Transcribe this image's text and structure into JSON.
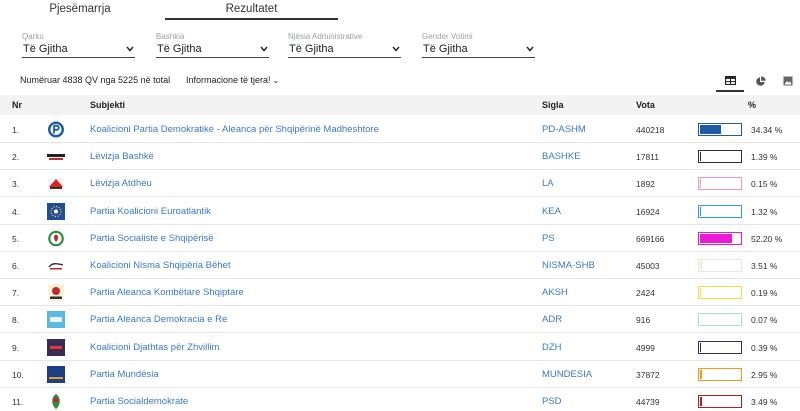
{
  "tabs": [
    {
      "label": "Pjesëmarrja",
      "active": false
    },
    {
      "label": "Rezultatet",
      "active": true
    }
  ],
  "filters": [
    {
      "label": "Qarku",
      "value": "Të Gjitha"
    },
    {
      "label": "Bashkia",
      "value": "Të Gjitha"
    },
    {
      "label": "Njësia Administrative",
      "value": "Të Gjitha"
    },
    {
      "label": "Gender Votimi",
      "value": "Të Gjitha"
    }
  ],
  "summary": "Numëruar 4838 QV nga 5225 në total",
  "more_info": "Informacione të tjera!",
  "views": [
    {
      "icon": "table-icon",
      "active": true
    },
    {
      "icon": "pie-chart-icon",
      "active": false
    },
    {
      "icon": "image-icon",
      "active": false
    }
  ],
  "table": {
    "headers": {
      "nr": "Nr",
      "subject": "Subjekti",
      "abbr": "Sigla",
      "votes": "Vota",
      "pct": "%"
    },
    "rows": [
      {
        "nr": "1.",
        "name": "Koalicioni Partia Demokratike - Aleanca për Shqipërinë Madheshtore",
        "abbr": "PD-ASHM",
        "votes": "440218",
        "pct": "34.34 %",
        "share": 34.34,
        "color": "#1e5ca8",
        "logo": "pd-logo"
      },
      {
        "nr": "2.",
        "name": "Lëvizja Bashkë",
        "abbr": "BASHKE",
        "votes": "17811",
        "pct": "1.39 %",
        "share": 1.39,
        "color": "#2b2b3b",
        "logo": "bashke-logo"
      },
      {
        "nr": "3.",
        "name": "Lëvizja Atdheu",
        "abbr": "LA",
        "votes": "1892",
        "pct": "0.15 %",
        "share": 0.15,
        "color": "#e89ac8",
        "logo": "la-logo"
      },
      {
        "nr": "4.",
        "name": "Partia Koalicioni Euroatlantik",
        "abbr": "KEA",
        "votes": "16924",
        "pct": "1.32 %",
        "share": 1.32,
        "color": "#2e9fd6",
        "logo": "kea-logo"
      },
      {
        "nr": "5.",
        "name": "Partia Socialiste e Shqipërisë",
        "abbr": "PS",
        "votes": "669166",
        "pct": "52.20 %",
        "share": 52.2,
        "color": "#ee18d8",
        "logo": "ps-logo"
      },
      {
        "nr": "6.",
        "name": "Koalicioni Nisma Shqipëria Bëhet",
        "abbr": "NISMA-SHB",
        "votes": "45003",
        "pct": "3.51 %",
        "share": 3.51,
        "color": "#f2e6d8",
        "logo": "nisma-logo"
      },
      {
        "nr": "7.",
        "name": "Partia Aleanca Kombëtare Shqiptare",
        "abbr": "AKSH",
        "votes": "2424",
        "pct": "0.19 %",
        "share": 0.19,
        "color": "#f0e040",
        "logo": "aksh-logo"
      },
      {
        "nr": "8.",
        "name": "Partia Aleanca Demokracia e Re",
        "abbr": "ADR",
        "votes": "916",
        "pct": "0.07 %",
        "share": 0.07,
        "color": "#a8ddf0",
        "logo": "adr-logo"
      },
      {
        "nr": "9.",
        "name": "Koalicioni Djathtas për Zhvillim",
        "abbr": "DZH",
        "votes": "4999",
        "pct": "0.39 %",
        "share": 0.39,
        "color": "#3b2a52",
        "logo": "dzh-logo"
      },
      {
        "nr": "10.",
        "name": "Partia Mundësia",
        "abbr": "MUNDESIA",
        "votes": "37872",
        "pct": "2.95 %",
        "share": 2.95,
        "color": "#f29a1a",
        "logo": "mundesia-logo"
      },
      {
        "nr": "11.",
        "name": "Partia Socialdemokrate",
        "abbr": "PSD",
        "votes": "44739",
        "pct": "3.49 %",
        "share": 3.49,
        "color": "#b02020",
        "logo": "psd-logo"
      }
    ]
  }
}
